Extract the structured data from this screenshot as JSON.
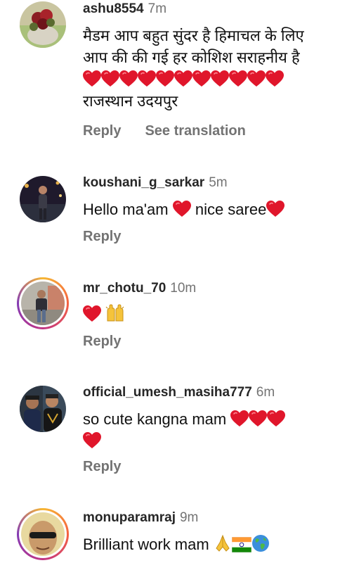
{
  "comments": [
    {
      "username": "ashu8554",
      "time": "7m",
      "text_line1": "मैडम आप बहुत सुंदर है हिमाचल के लिए",
      "text_line2": "आप की की गई हर कोशिश सराहनीय है",
      "text_line3": "राजस्थान उदयपुर",
      "hearts_count": 11,
      "reply_label": "Reply",
      "translate_label": "See translation"
    },
    {
      "username": "koushani_g_sarkar",
      "time": "5m",
      "text_a": "Hello ma'am",
      "text_b": "nice saree",
      "reply_label": "Reply"
    },
    {
      "username": "mr_chotu_70",
      "time": "10m",
      "reply_label": "Reply"
    },
    {
      "username": "official_umesh_masiha777",
      "time": "6m",
      "text_a": "so cute kangna mam",
      "reply_label": "Reply"
    },
    {
      "username": "monuparamraj",
      "time": "9m",
      "text_a": "Brilliant work mam"
    }
  ],
  "icons": {
    "heart": "heart-emoji",
    "raising_hands": "raising-hands-emoji",
    "folded_hands": "folded-hands-emoji",
    "india_flag": "india-flag-emoji",
    "globe": "globe-emoji"
  },
  "colors": {
    "heart": "#e0162b",
    "secondary_text": "#737373",
    "username": "#262626"
  }
}
